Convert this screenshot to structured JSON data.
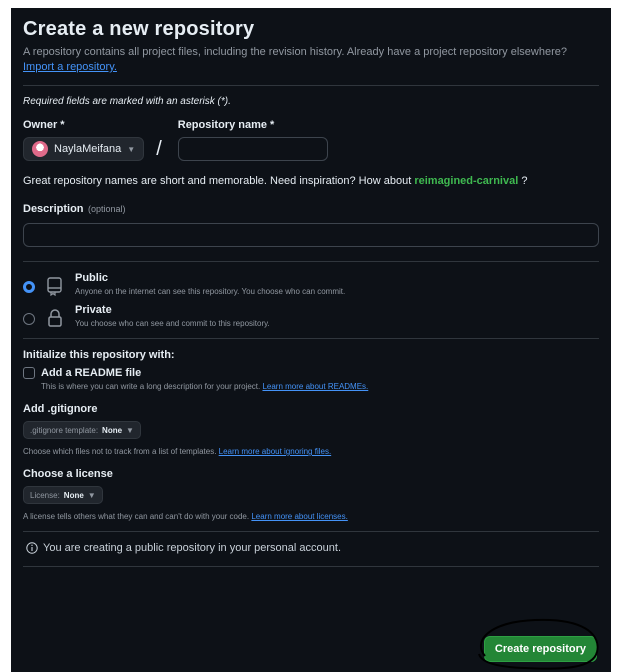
{
  "header": {
    "title": "Create a new repository",
    "subtitle": "A repository contains all project files, including the revision history. Already have a project repository elsewhere?",
    "import_link": "Import a repository."
  },
  "required_note": "Required fields are marked with an asterisk (*).",
  "owner": {
    "label": "Owner *",
    "value": "NaylaMeifana"
  },
  "repo_name": {
    "label": "Repository name *",
    "value": ""
  },
  "inspiration": {
    "prefix": "Great repository names are short and memorable. Need inspiration? How about",
    "suggestion": "reimagined-carnival",
    "suffix": "?"
  },
  "description": {
    "label": "Description",
    "optional": "(optional)",
    "value": ""
  },
  "visibility": {
    "public": {
      "title": "Public",
      "desc": "Anyone on the internet can see this repository. You choose who can commit.",
      "checked": true
    },
    "private": {
      "title": "Private",
      "desc": "You choose who can see and commit to this repository.",
      "checked": false
    }
  },
  "init": {
    "heading": "Initialize this repository with:",
    "readme_label": "Add a README file",
    "readme_desc": "This is where you can write a long description for your project.",
    "readme_link": "Learn more about READMEs."
  },
  "gitignore": {
    "heading": "Add .gitignore",
    "select_prefix": ".gitignore template:",
    "select_value": "None",
    "desc": "Choose which files not to track from a list of templates.",
    "link": "Learn more about ignoring files."
  },
  "license": {
    "heading": "Choose a license",
    "select_prefix": "License:",
    "select_value": "None",
    "desc": "A license tells others what they can and can't do with your code.",
    "link": "Learn more about licenses."
  },
  "info": "You are creating a public repository in your personal account.",
  "create_button": "Create repository",
  "colors": {
    "accent_blue": "#4493f8",
    "success_green": "#238636",
    "background": "#0d1117",
    "suggestion": "#3fb950"
  }
}
